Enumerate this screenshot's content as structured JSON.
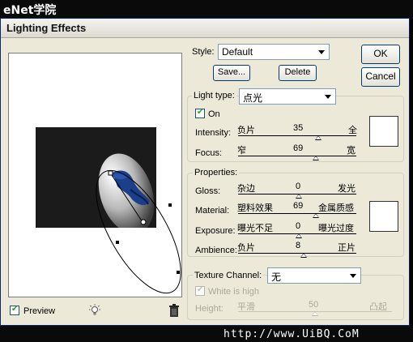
{
  "watermark_top": "eNet学院",
  "window": {
    "title": "Lighting Effects"
  },
  "preview": {
    "label": "Preview"
  },
  "style": {
    "label": "Style:",
    "value": "Default",
    "save_label": "Save...",
    "delete_label": "Delete",
    "ok_label": "OK",
    "cancel_label": "Cancel"
  },
  "light_type": {
    "label": "Light type:",
    "value": "点光",
    "on_label": "On",
    "intensity": {
      "label": "Intensity:",
      "min": "负片",
      "max": "全",
      "value": "35"
    },
    "focus": {
      "label": "Focus:",
      "min": "窄",
      "max": "宽",
      "value": "69"
    }
  },
  "properties": {
    "title": "Properties:",
    "gloss": {
      "label": "Gloss:",
      "min": "杂边",
      "max": "发光",
      "value": "0"
    },
    "material": {
      "label": "Material:",
      "min": "塑料效果",
      "max": "金属质感",
      "value": "69"
    },
    "exposure": {
      "label": "Exposure:",
      "min": "曝光不足",
      "max": "曝光过度",
      "value": "0"
    },
    "ambience": {
      "label": "Ambience:",
      "min": "负片",
      "max": "正片",
      "value": "8"
    }
  },
  "texture": {
    "label": "Texture Channel:",
    "value": "无",
    "white_is_high": "White is high",
    "height": {
      "label": "Height:",
      "min": "平滑",
      "max": "凸起",
      "value": "50"
    }
  },
  "watermark_bottom": "http://www.UiBQ.CoM",
  "colors": {
    "swatch_light": "#ffffff",
    "swatch_properties": "#ffffff",
    "accent": "#0a246a"
  }
}
